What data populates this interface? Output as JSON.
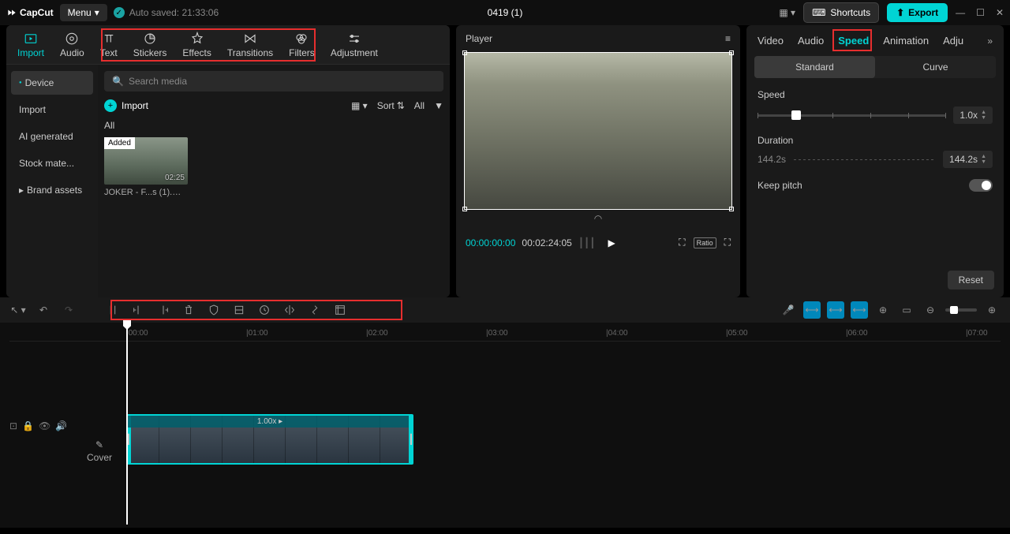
{
  "titlebar": {
    "logo": "CapCut",
    "menu": "Menu",
    "autosaved": "Auto saved: 21:33:06",
    "project": "0419 (1)",
    "shortcuts": "Shortcuts",
    "export": "Export"
  },
  "tabs": {
    "import": "Import",
    "audio": "Audio",
    "text": "Text",
    "stickers": "Stickers",
    "effects": "Effects",
    "transitions": "Transitions",
    "filters": "Filters",
    "adjustment": "Adjustment"
  },
  "sidebar": {
    "device": "Device",
    "import": "Import",
    "ai_generated": "AI generated",
    "stock": "Stock mate...",
    "brand": "Brand assets"
  },
  "media": {
    "search_placeholder": "Search media",
    "import_btn": "Import",
    "sort": "Sort",
    "all": "All",
    "all_label": "All",
    "thumb": {
      "added": "Added",
      "duration": "02:25",
      "name": "JOKER - F...s (1).mp4"
    }
  },
  "player": {
    "title": "Player",
    "current": "00:00:00:00",
    "total": "00:02:24:05",
    "ratio": "Ratio"
  },
  "inspector": {
    "tabs": {
      "video": "Video",
      "audio": "Audio",
      "speed": "Speed",
      "animation": "Animation",
      "adjust": "Adju"
    },
    "subtabs": {
      "standard": "Standard",
      "curve": "Curve"
    },
    "speed_label": "Speed",
    "speed_value": "1.0x",
    "duration_label": "Duration",
    "duration_value_left": "144.2s",
    "duration_value": "144.2s",
    "keep_pitch": "Keep pitch",
    "reset": "Reset"
  },
  "timeline": {
    "cover": "Cover",
    "clip_speed": "1.00x",
    "ruler": [
      "|00:00",
      "|01:00",
      "|02:00",
      "|03:00",
      "|04:00",
      "|05:00",
      "|06:00",
      "|07:00"
    ]
  }
}
